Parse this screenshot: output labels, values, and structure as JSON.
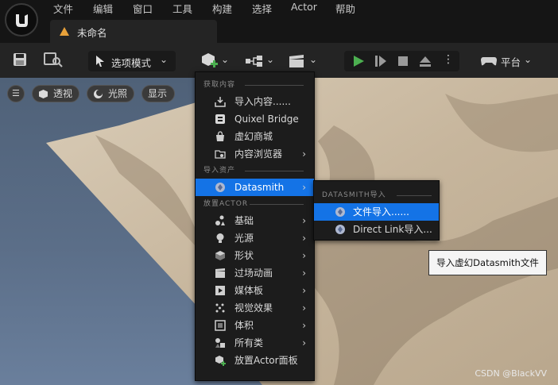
{
  "menu": [
    "文件",
    "编辑",
    "窗口",
    "工具",
    "构建",
    "选择",
    "Actor",
    "帮助"
  ],
  "tab": {
    "title": "未命名"
  },
  "toolbar": {
    "mode_label": "选项模式",
    "platform_label": "平台"
  },
  "viewport": {
    "perspective": "透视",
    "lighting": "光照",
    "show": "显示"
  },
  "add_menu": {
    "section_content": "获取内容",
    "items_content": [
      {
        "label": "导入内容......",
        "icon": "import-icon"
      },
      {
        "label": "Quixel Bridge",
        "icon": "bridge-icon"
      },
      {
        "label": "虚幻商城",
        "icon": "marketplace-icon"
      },
      {
        "label": "内容浏览器",
        "icon": "content-browser-icon",
        "submenu": true
      }
    ],
    "section_import": "导入资产",
    "items_import": [
      {
        "label": "Datasmith",
        "icon": "datasmith-icon",
        "submenu": true,
        "highlighted": true
      }
    ],
    "section_place": "放置ACTOR",
    "items_place": [
      {
        "label": "基础",
        "icon": "basic-icon",
        "submenu": true
      },
      {
        "label": "光源",
        "icon": "light-icon",
        "submenu": true
      },
      {
        "label": "形状",
        "icon": "shape-icon",
        "submenu": true
      },
      {
        "label": "过场动画",
        "icon": "cinematic-icon",
        "submenu": true
      },
      {
        "label": "媒体板",
        "icon": "media-icon",
        "submenu": true
      },
      {
        "label": "视觉效果",
        "icon": "vfx-icon",
        "submenu": true
      },
      {
        "label": "体积",
        "icon": "volume-icon",
        "submenu": true
      },
      {
        "label": "所有类",
        "icon": "all-classes-icon",
        "submenu": true
      },
      {
        "label": "放置Actor面板",
        "icon": "place-actor-icon"
      }
    ]
  },
  "datasmith_menu": {
    "section": "DATASMITH导入",
    "items": [
      {
        "label": "文件导入......",
        "highlighted": true
      },
      {
        "label": "Direct Link导入..."
      }
    ]
  },
  "tooltip": "导入虚幻Datasmith文件",
  "watermark": "CSDN @BlackVV",
  "colors": {
    "highlight": "#1473e6",
    "play_green": "#4caf50",
    "warning_orange": "#e8a13a"
  }
}
